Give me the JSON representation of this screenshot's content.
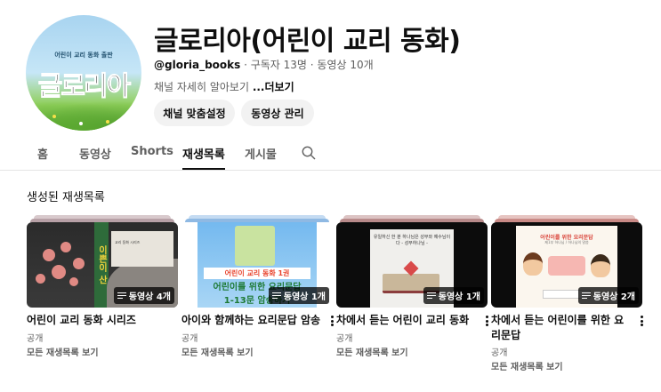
{
  "channel": {
    "avatar_subtitle": "어린이 교리 동화 출판",
    "avatar_logo": "글로리아",
    "title": "글로리아(어린이 교리 동화)",
    "handle": "@gloria_books",
    "subscribers": " · 구독자 13명",
    "video_count": " · 동영상 10개",
    "description": "채널 자세히 알아보기 ",
    "more": "...더보기",
    "customize_button": "채널 맞춤설정",
    "manage_button": "동영상 관리"
  },
  "tabs": [
    {
      "label": "홈"
    },
    {
      "label": "동영상"
    },
    {
      "label": "Shorts"
    },
    {
      "label": "재생목록"
    },
    {
      "label": "게시물"
    }
  ],
  "active_tab": "재생목록",
  "section_title": "생성된 재생목록",
  "playlists": [
    {
      "title": "어린이 교리 동화 시리즈",
      "badge": "동영상 4개",
      "visibility": "공개",
      "link": "모든 재생목록 보기",
      "thumb_strip": "이쁜이 산",
      "thumb_panel": "교리 동화 시리즈",
      "stack_color_1": "#b7a0a6",
      "stack_color_2": "#d8c9cc"
    },
    {
      "title": "아이와 함께하는 요리문답 암송",
      "badge": "동영상 1개",
      "visibility": "공개",
      "link": "모든 재생목록 보기",
      "thumb_line1": "어린이 교리 동화 1권",
      "thumb_line2": "어린이를 위한 요리문답",
      "thumb_line3": "1-13문 암송하기",
      "stack_color_1": "#8fb9e3",
      "stack_color_2": "#c4dbf2"
    },
    {
      "title": "차에서 듣는 어린이 교리 동화",
      "badge": "동영상 1개",
      "visibility": "공개",
      "link": "모든 재생목록 보기",
      "thumb_text": "유일하신 한 분 하나님은 성부와 예수님이다 - 성부하나님 -",
      "stack_color_1": "#b88a8a",
      "stack_color_2": "#dcc3c3"
    },
    {
      "title": "차에서 듣는 어린이를 위한 요리문답",
      "badge": "동영상 2개",
      "visibility": "공개",
      "link": "모든 재생목록 보기",
      "thumb_head": "어린이를 위한 요리문답",
      "thumb_sub": "제1부 하나님 / 하나님의 말씀",
      "stack_color_1": "#c98a86",
      "stack_color_2": "#e6c4c1"
    }
  ],
  "colors": {
    "text_primary": "#0f0f0f",
    "text_secondary": "#606060",
    "chip_bg": "#f2f2f2"
  }
}
